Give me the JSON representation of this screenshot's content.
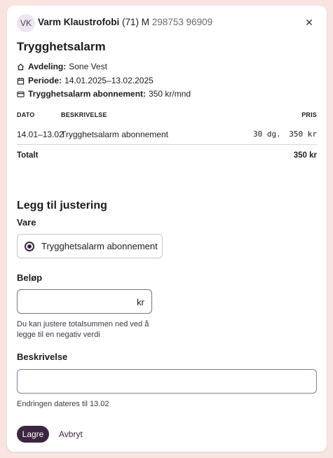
{
  "header": {
    "avatar_initials": "VK",
    "patient_name": "Varm Klaustrofobi",
    "patient_age_gender": "(71) M",
    "patient_id": "298753 96909"
  },
  "title": "Trygghetsalarm",
  "info": {
    "department_label": "Avdeling:",
    "department_value": "Sone Vest",
    "period_label": "Periode:",
    "period_value": "14.01.2025–13.02.2025",
    "subscription_label": "Trygghetsalarm abonnement:",
    "subscription_value": "350 kr/mnd"
  },
  "table": {
    "headers": {
      "date": "DATO",
      "description": "BESKRIVELSE",
      "price": "PRIS"
    },
    "rows": [
      {
        "date": "14.01–13.02",
        "description": "Trygghetsalarm abonnement",
        "quantity": "30 dg.",
        "price": "350 kr"
      }
    ],
    "total_label": "Totalt",
    "total_value": "350 kr"
  },
  "adjustment": {
    "section_title": "Legg til justering",
    "item_label": "Vare",
    "item_option": "Trygghetsalarm abonnement",
    "amount_label": "Beløp",
    "amount_value": "",
    "amount_suffix": "kr",
    "amount_helper": "Du kan justere totalsummen ned ved å legge til en negativ verdi",
    "description_label": "Beskrivelse",
    "description_value": "",
    "date_note": "Endringen dateres til 13.02"
  },
  "actions": {
    "save_label": "Lagre",
    "cancel_label": "Avbryt"
  },
  "icons": {
    "close": "close-icon",
    "department": "home-icon",
    "period": "calendar-icon",
    "subscription": "credit-card-icon"
  },
  "colors": {
    "primary": "#3b2541",
    "background": "#f8e4e1",
    "avatar_bg": "#ece6f0"
  }
}
